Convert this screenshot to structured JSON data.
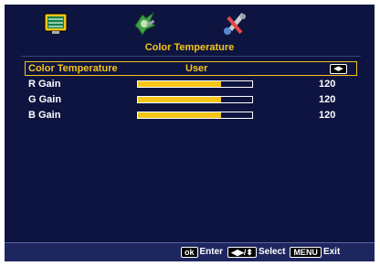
{
  "menu": {
    "title": "Color Temperature",
    "icons": [
      "picture-icon",
      "settings-icon",
      "tools-icon"
    ]
  },
  "selected_row": {
    "label": "Color Temperature",
    "value": "User",
    "arrow_symbol": "◀▶"
  },
  "gains": [
    {
      "label": "R Gain",
      "value": "120",
      "fill_percent": 73
    },
    {
      "label": "G Gain",
      "value": "120",
      "fill_percent": 73
    },
    {
      "label": "B Gain",
      "value": "120",
      "fill_percent": 73
    }
  ],
  "footer": {
    "ok_key": "ok",
    "enter_label": "Enter",
    "nav_key": "◀▶/⬍",
    "select_label": "Select",
    "menu_key": "MENU",
    "exit_label": "Exit"
  },
  "colors": {
    "background": "#0e1440",
    "highlight": "#f5c518",
    "footer": "#1e2660"
  }
}
